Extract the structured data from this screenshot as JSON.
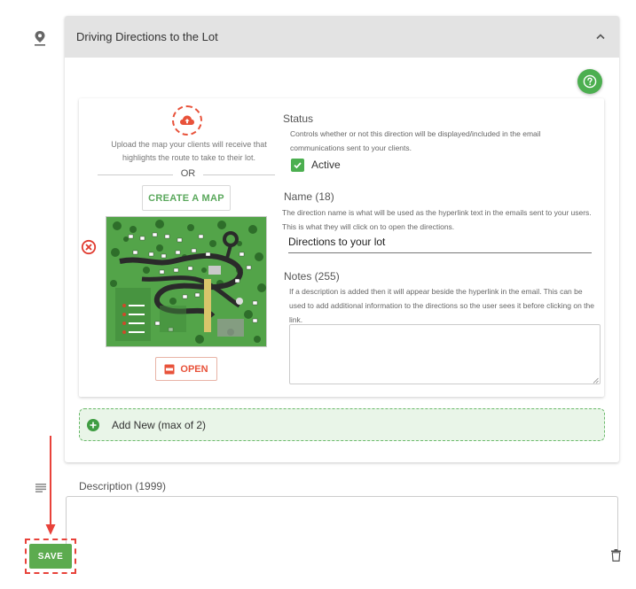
{
  "panel": {
    "title": "Driving Directions to the Lot",
    "icons": {
      "location": "location-pin-icon",
      "collapse": "chevron-up-icon",
      "help": "question-circle-icon"
    }
  },
  "direction": {
    "upload_text": "Upload the map your clients will receive that highlights the route to take to their lot.",
    "or_text": "OR",
    "create_map_label": "CREATE A MAP",
    "open_label": "OPEN",
    "status": {
      "label": "Status",
      "help": "Controls whether or not this direction will be displayed/included in the email communications sent to your clients.",
      "checkbox_label": "Active",
      "checked": true
    },
    "name": {
      "label": "Name (18)",
      "help": "The direction name is what will be used as the hyperlink text in the emails sent to your users. This is what they will click on to open the directions.",
      "value": "Directions to your lot"
    },
    "notes": {
      "label": "Notes (255)",
      "help": "If a description is added then it will appear beside the hyperlink in the email. This can be used to add additional information to the directions so the user sees it before clicking on the link.",
      "value": ""
    }
  },
  "add_new_label": "Add New (max of 2)",
  "description": {
    "label": "Description (1999)",
    "value": ""
  },
  "save_label": "SAVE",
  "colors": {
    "accent_green": "#4caf50",
    "highlight_red": "#e8423a",
    "header_gray": "#e3e3e3"
  }
}
